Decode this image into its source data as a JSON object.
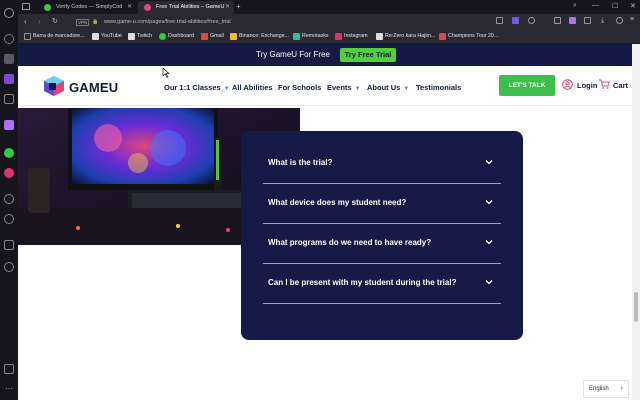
{
  "browser": {
    "tabs": [
      {
        "title": "Verify Codes — SimplyCod"
      },
      {
        "title": "Free Trial Abilities – GameU"
      }
    ],
    "url": "www.game-u.com/pages/free-trial-abilities#free_trial",
    "vpn_label": "VPN",
    "bookmarks": [
      {
        "label": "Barra de marcadore..."
      },
      {
        "label": "YouTube"
      },
      {
        "label": "Twitch"
      },
      {
        "label": "Dashboard"
      },
      {
        "label": "Gmail"
      },
      {
        "label": "Binance: Exchange..."
      },
      {
        "label": "Remotasks"
      },
      {
        "label": "Instagram"
      },
      {
        "label": "Re:Zero kara Hajim..."
      },
      {
        "label": "Champions Tour 20..."
      }
    ]
  },
  "promo": {
    "text": "Try GameU For Free",
    "button": "Try Free Trial"
  },
  "header": {
    "logo_text": "GAMEU",
    "nav": [
      {
        "label": "Our 1:1 Classes",
        "has_caret": true
      },
      {
        "label": "All Abilities",
        "has_caret": false
      },
      {
        "label": "For Schools",
        "has_caret": false
      },
      {
        "label": "Events",
        "has_caret": true
      },
      {
        "label": "About Us",
        "has_caret": true
      },
      {
        "label": "Testimonials",
        "has_caret": false
      }
    ],
    "cta": "LET'S TALK",
    "login": "Login",
    "cart": "Cart"
  },
  "faq": {
    "items": [
      {
        "question": "What is the trial?"
      },
      {
        "question": "What device does my student need?"
      },
      {
        "question": "What programs do we need to have ready?"
      },
      {
        "question": "Can I be present with my student during the trial?"
      }
    ]
  },
  "language": "English",
  "colors": {
    "navy": "#151a47",
    "green": "#3cbf4b",
    "accent_blue": "#5b7fe0"
  }
}
